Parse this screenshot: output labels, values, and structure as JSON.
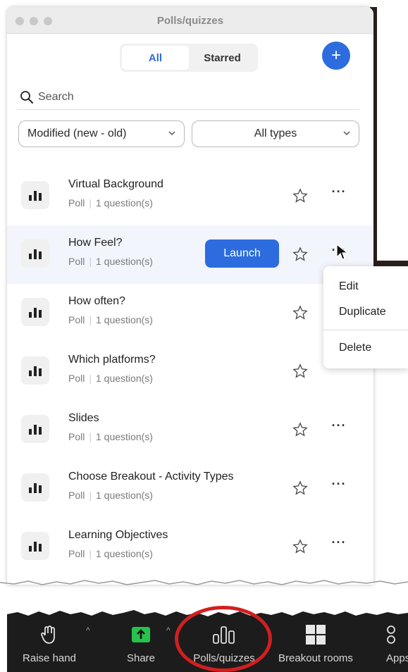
{
  "window": {
    "title": "Polls/quizzes"
  },
  "tabs": [
    {
      "label": "All",
      "active": true
    },
    {
      "label": "Starred",
      "active": false
    }
  ],
  "add_button": {
    "label": "+"
  },
  "search": {
    "placeholder": "Search"
  },
  "filters": {
    "sort": "Modified (new - old)",
    "type": "All types"
  },
  "polls": [
    {
      "name": "Virtual Background",
      "kind": "Poll",
      "questions": "1 question(s)"
    },
    {
      "name": "How Feel?",
      "kind": "Poll",
      "questions": "1 question(s)",
      "hovered": true,
      "launch_label": "Launch"
    },
    {
      "name": "How often?",
      "kind": "Poll",
      "questions": "1 question(s)"
    },
    {
      "name": "Which platforms?",
      "kind": "Poll",
      "questions": "1 question(s)"
    },
    {
      "name": "Slides",
      "kind": "Poll",
      "questions": "1 question(s)"
    },
    {
      "name": "Choose Breakout - Activity Types",
      "kind": "Poll",
      "questions": "1 question(s)"
    },
    {
      "name": "Learning Objectives",
      "kind": "Poll",
      "questions": "1 question(s)"
    }
  ],
  "context_menu": {
    "edit": "Edit",
    "duplicate": "Duplicate",
    "delete": "Delete"
  },
  "toolbar": {
    "raise_hand": "Raise hand",
    "share": "Share",
    "polls": "Polls/quizzes",
    "breakout": "Breakout rooms",
    "apps": "Apps"
  },
  "colors": {
    "accent": "#2d6cdf",
    "highlight_ring": "#d21f1f",
    "toolbar_bg": "#1c1c1c",
    "share_green": "#27c24c"
  },
  "icons": {
    "poll": "bar-chart-icon",
    "star": "star-outline-icon",
    "more": "ellipsis-icon"
  }
}
